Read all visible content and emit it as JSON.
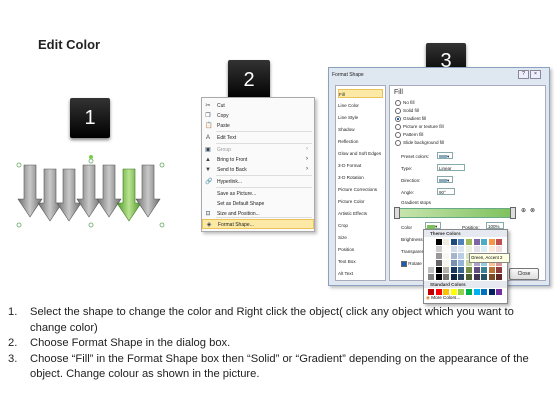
{
  "title": "Edit Color",
  "steps": [
    "1",
    "2",
    "3"
  ],
  "context_menu": {
    "items": [
      {
        "icon": "scissors-icon",
        "label": "Cut",
        "arrow": false,
        "disabled": false
      },
      {
        "icon": "copy-icon",
        "label": "Copy",
        "arrow": false,
        "disabled": false
      },
      {
        "icon": "paste-icon",
        "label": "Paste",
        "arrow": false,
        "disabled": false
      },
      {
        "icon": "edit-text-icon",
        "label": "Edit Text",
        "arrow": false,
        "disabled": false
      },
      {
        "icon": "group-icon",
        "label": "Group",
        "arrow": true,
        "disabled": true
      },
      {
        "icon": "bring-front-icon",
        "label": "Bring to Front",
        "arrow": true,
        "disabled": false
      },
      {
        "icon": "send-back-icon",
        "label": "Send to Back",
        "arrow": true,
        "disabled": false
      },
      {
        "icon": "hyperlink-icon",
        "label": "Hyperlink...",
        "arrow": false,
        "disabled": false
      },
      {
        "icon": "",
        "label": "Save as Picture...",
        "arrow": false,
        "disabled": false
      },
      {
        "icon": "",
        "label": "Set as Default Shape",
        "arrow": false,
        "disabled": false
      },
      {
        "icon": "size-icon",
        "label": "Size and Position...",
        "arrow": false,
        "disabled": false
      },
      {
        "icon": "format-shape-icon",
        "label": "Format Shape...",
        "arrow": false,
        "disabled": false,
        "highlight": true
      }
    ]
  },
  "dialog": {
    "title": "Format Shape",
    "nav": [
      "Fill",
      "Line Color",
      "Line Style",
      "Shadow",
      "Reflection",
      "Glow and Soft Edges",
      "3-D Format",
      "3-D Rotation",
      "Picture Corrections",
      "Picture Color",
      "Artistic Effects",
      "Crop",
      "Size",
      "Position",
      "Text Box",
      "Alt Text"
    ],
    "panel_heading": "Fill",
    "fill_options": [
      "No fill",
      "Solid fill",
      "Gradient fill",
      "Picture or texture fill",
      "Pattern fill",
      "Slide background fill"
    ],
    "selected_fill": 2,
    "preset_colors_label": "Preset colors:",
    "type_label": "Type:",
    "type_value": "Linear",
    "direction_label": "Direction:",
    "angle_label": "Angle:",
    "angle_value": "90°",
    "gradient_stops_label": "Gradient stops",
    "color_label": "Color",
    "position_label": "Position:",
    "position_value": "100%",
    "brightness_label": "Brightness",
    "transparency_label": "Transparency",
    "rotate_label": "Rotate",
    "close_label": "Close"
  },
  "palette": {
    "theme_label": "Theme Colors",
    "standard_label": "Standard Colors",
    "more_label": "More Colors...",
    "tooltip": "Green, Accent 2",
    "theme_top": [
      "#ffffff",
      "#000000",
      "#eeece1",
      "#1f497d",
      "#4f81bd",
      "#9bbb59",
      "#8064a2",
      "#4bacc6",
      "#f79646",
      "#c0504d"
    ],
    "standard": [
      "#c00000",
      "#ff0000",
      "#ffc000",
      "#ffff00",
      "#92d050",
      "#00b050",
      "#00b0f0",
      "#0070c0",
      "#002060",
      "#7030a0"
    ]
  },
  "instructions": [
    {
      "num": "1.",
      "text": "Select the shape to change the color and Right click the object( click any object which you want to change color)"
    },
    {
      "num": "2.",
      "text": "Choose Format Shape in the dialog box."
    },
    {
      "num": "3.",
      "text": "Choose “Fill” in the Format Shape box then “Solid” or “Gradient” depending on the appearance of the object. Change colour as shown in the picture."
    }
  ]
}
